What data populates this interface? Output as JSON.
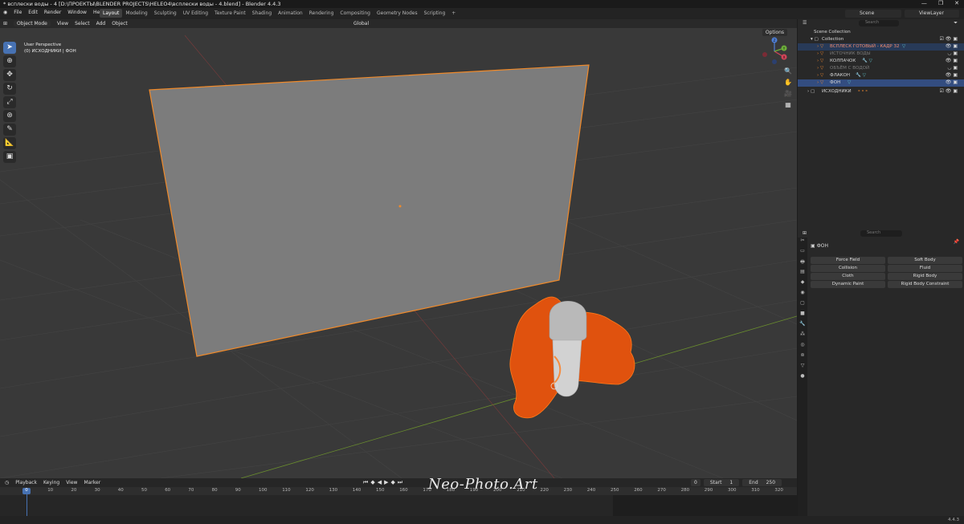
{
  "window": {
    "title": "* всплески воды - 4 [D:\\ПРОЕКТЫ\\BLENDER PROJECTS\\HELEO4\\всплески воды - 4.blend] - Blender 4.4.3",
    "minimize": "—",
    "maximize": "❐",
    "close": "✕"
  },
  "menu": [
    "File",
    "Edit",
    "Render",
    "Window",
    "Help"
  ],
  "workspaces": [
    "Layout",
    "Modeling",
    "Sculpting",
    "UV Editing",
    "Texture Paint",
    "Shading",
    "Animation",
    "Rendering",
    "Compositing",
    "Geometry Nodes",
    "Scripting",
    "+"
  ],
  "active_workspace": "Layout",
  "scene": "Scene",
  "view_layer": "ViewLayer",
  "viewport": {
    "mode": "Object Mode",
    "header_items": [
      "View",
      "Select",
      "Add",
      "Object"
    ],
    "orientation": "Global",
    "options": "Options",
    "info_line1": "User Perspective",
    "info_line2": "(0) ИСХОДНИКИ | ФОН",
    "watermark": "Neo-Photo.Art",
    "gizmo_axes": [
      "Z",
      "Y",
      "X"
    ]
  },
  "timeline": {
    "header_items": [
      "Playback",
      "Keying",
      "View",
      "Marker"
    ],
    "current_frame": "0",
    "start_label": "Start",
    "start_value": "1",
    "end_label": "End",
    "end_value": "250",
    "ticks": [
      "0",
      "10",
      "20",
      "30",
      "40",
      "50",
      "60",
      "70",
      "80",
      "90",
      "100",
      "110",
      "120",
      "130",
      "140",
      "150",
      "160",
      "170",
      "180",
      "190",
      "200",
      "210",
      "220",
      "230",
      "240",
      "250",
      "260",
      "270",
      "280",
      "290",
      "300",
      "310",
      "320"
    ]
  },
  "outliner": {
    "search_placeholder": "Search",
    "scene_collection": "Scene Collection",
    "collection": "Collection",
    "items": [
      {
        "label": "ВСПЛЕСК ГОТОВЫЙ - КАДР 32",
        "state": "selected-dim"
      },
      {
        "label": "ИСТОЧНИК ВОДЫ",
        "state": "hidden"
      },
      {
        "label": "КОЛПАЧОК",
        "state": "normal"
      },
      {
        "label": "ОБЪЁМ С ВОДОЙ",
        "state": "hidden"
      },
      {
        "label": "ФЛАКОН",
        "state": "normal"
      },
      {
        "label": "ФОН",
        "state": "active"
      }
    ],
    "sources": "ИСХОДНИКИ"
  },
  "properties": {
    "search_placeholder": "Search",
    "object_name": "ФОН",
    "buttons_left": [
      "Force Field",
      "Collision",
      "Cloth",
      "Dynamic Paint"
    ],
    "buttons_right": [
      "Soft Body",
      "Fluid",
      "Rigid Body",
      "Rigid Body Constraint"
    ]
  },
  "status": {
    "version": "4.4.3"
  },
  "colors": {
    "accent": "#4772b3",
    "selection_outline": "#f08a2a",
    "fluid": "#e0520e"
  }
}
